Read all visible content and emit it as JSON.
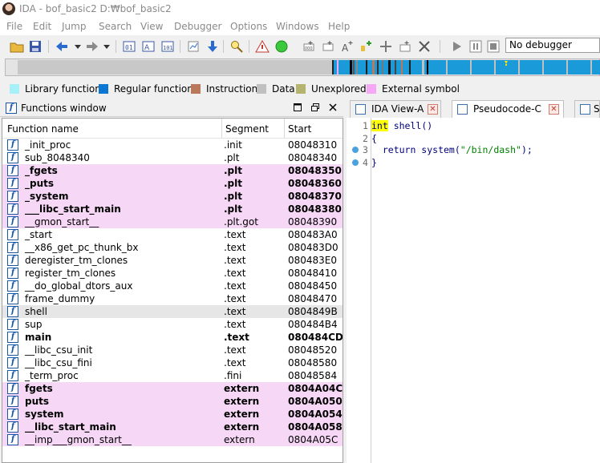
{
  "window": {
    "title": "IDA - bof_basic2 D:₩bof_basic2"
  },
  "menu": [
    "File",
    "Edit",
    "Jump",
    "Search",
    "View",
    "Debugger",
    "Options",
    "Windows",
    "Help"
  ],
  "toolbar": {
    "debugger_select": "No debugger"
  },
  "legend": [
    {
      "label": "Library function",
      "color": "#a8f0f8"
    },
    {
      "label": "Regular function",
      "color": "#0a78d2"
    },
    {
      "label": "Instruction",
      "color": "#b9785a"
    },
    {
      "label": "Data",
      "color": "#c0c0c0"
    },
    {
      "label": "Unexplored",
      "color": "#b4b46e"
    },
    {
      "label": "External symbol",
      "color": "#f6a8f6"
    }
  ],
  "functions_window": {
    "title": "Functions window",
    "columns": [
      "Function name",
      "Segment",
      "Start"
    ],
    "rows": [
      {
        "name": "_init_proc",
        "segment": ".init",
        "start": "08048310",
        "style": "normal"
      },
      {
        "name": "sub_8048340",
        "segment": ".plt",
        "start": "08048340",
        "style": "normal"
      },
      {
        "name": "_fgets",
        "segment": ".plt",
        "start": "08048350",
        "style": "pink-bold"
      },
      {
        "name": "_puts",
        "segment": ".plt",
        "start": "08048360",
        "style": "pink-bold"
      },
      {
        "name": "_system",
        "segment": ".plt",
        "start": "08048370",
        "style": "pink-bold"
      },
      {
        "name": "___libc_start_main",
        "segment": ".plt",
        "start": "08048380",
        "style": "pink-bold"
      },
      {
        "name": "__gmon_start__",
        "segment": ".plt.got",
        "start": "08048390",
        "style": "pink"
      },
      {
        "name": "_start",
        "segment": ".text",
        "start": "080483A0",
        "style": "normal"
      },
      {
        "name": "__x86_get_pc_thunk_bx",
        "segment": ".text",
        "start": "080483D0",
        "style": "normal"
      },
      {
        "name": "deregister_tm_clones",
        "segment": ".text",
        "start": "080483E0",
        "style": "normal"
      },
      {
        "name": "register_tm_clones",
        "segment": ".text",
        "start": "08048410",
        "style": "normal"
      },
      {
        "name": "__do_global_dtors_aux",
        "segment": ".text",
        "start": "08048450",
        "style": "normal"
      },
      {
        "name": "frame_dummy",
        "segment": ".text",
        "start": "08048470",
        "style": "normal"
      },
      {
        "name": "shell",
        "segment": ".text",
        "start": "0804849B",
        "style": "selected"
      },
      {
        "name": "sup",
        "segment": ".text",
        "start": "080484B4",
        "style": "normal"
      },
      {
        "name": "main",
        "segment": ".text",
        "start": "080484CD",
        "style": "bold"
      },
      {
        "name": "__libc_csu_init",
        "segment": ".text",
        "start": "08048520",
        "style": "normal"
      },
      {
        "name": "__libc_csu_fini",
        "segment": ".text",
        "start": "08048580",
        "style": "normal"
      },
      {
        "name": "_term_proc",
        "segment": ".fini",
        "start": "08048584",
        "style": "normal"
      },
      {
        "name": "fgets",
        "segment": "extern",
        "start": "0804A04C",
        "style": "pink-bold"
      },
      {
        "name": "puts",
        "segment": "extern",
        "start": "0804A050",
        "style": "pink-bold"
      },
      {
        "name": "system",
        "segment": "extern",
        "start": "0804A054",
        "style": "pink-bold"
      },
      {
        "name": "__libc_start_main",
        "segment": "extern",
        "start": "0804A058",
        "style": "pink-bold"
      },
      {
        "name": "__imp___gmon_start__",
        "segment": "extern",
        "start": "0804A05C",
        "style": "pink"
      }
    ]
  },
  "tabs": [
    {
      "label": "IDA View-A",
      "active": false
    },
    {
      "label": "Pseudocode-C",
      "active": true
    },
    {
      "label": "S",
      "active": false
    }
  ],
  "pseudocode": {
    "lines": [
      {
        "num": "1",
        "kw": "int",
        "rest": " shell()",
        "bp": false
      },
      {
        "num": "2",
        "text": "{",
        "bp": false
      },
      {
        "num": "3",
        "pre": "  return system(",
        "str": "\"/bin/dash\"",
        "post": ");",
        "bp": true
      },
      {
        "num": "4",
        "text": "}",
        "bp": true
      }
    ]
  }
}
